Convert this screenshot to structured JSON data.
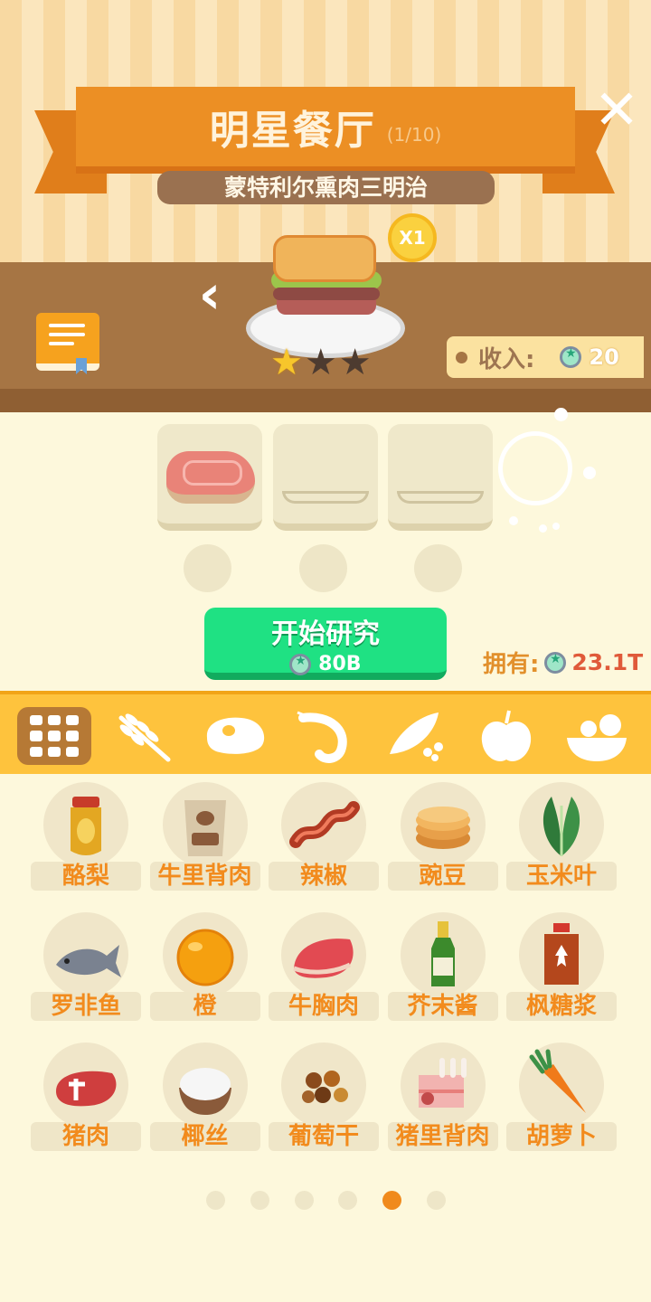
{
  "header": {
    "title": "明星餐厅",
    "progress": "(1/10)",
    "dish_name": "蒙特利尔熏肉三明治",
    "multiplier": "X1",
    "rating": 1,
    "rating_max": 3,
    "income_label": "收入:",
    "income_value": "20"
  },
  "research": {
    "slots": [
      {
        "filled": true,
        "item": "steak-icon"
      },
      {
        "filled": false,
        "item": "empty-plate-icon"
      },
      {
        "filled": false,
        "item": "empty-plate-icon"
      }
    ],
    "start_label": "开始研究",
    "start_cost": "80B",
    "owned_label": "拥有:",
    "owned_value": "23.1T"
  },
  "categories": [
    {
      "icon": "grid-icon",
      "active": true
    },
    {
      "icon": "wheat-icon",
      "active": false
    },
    {
      "icon": "meat-icon",
      "active": false
    },
    {
      "icon": "shrimp-icon",
      "active": false
    },
    {
      "icon": "pea-pod-icon",
      "active": false
    },
    {
      "icon": "apple-icon",
      "active": false
    },
    {
      "icon": "salad-bowl-icon",
      "active": false
    }
  ],
  "ingredients": [
    {
      "label": "酪梨",
      "icon": "honey-jar-icon"
    },
    {
      "label": "牛里背肉",
      "icon": "cocoa-bag-icon"
    },
    {
      "label": "辣椒",
      "icon": "bacon-icon"
    },
    {
      "label": "豌豆",
      "icon": "pancake-icon"
    },
    {
      "label": "玉米叶",
      "icon": "spinach-icon"
    },
    {
      "label": "罗非鱼",
      "icon": "fish-icon"
    },
    {
      "label": "橙",
      "icon": "orange-icon"
    },
    {
      "label": "牛胸肉",
      "icon": "beef-slab-icon"
    },
    {
      "label": "芥末酱",
      "icon": "sauce-bottle-icon"
    },
    {
      "label": "枫糖浆",
      "icon": "maple-syrup-icon"
    },
    {
      "label": "猪肉",
      "icon": "t-bone-icon"
    },
    {
      "label": "椰丝",
      "icon": "rice-bowl-icon"
    },
    {
      "label": "葡萄干",
      "icon": "raisins-icon"
    },
    {
      "label": "猪里背肉",
      "icon": "pork-rack-icon"
    },
    {
      "label": "胡萝卜",
      "icon": "carrot-icon"
    }
  ],
  "pager": {
    "count": 6,
    "active_index": 4
  },
  "colors": {
    "accent": "#f08a1c",
    "start_button": "#1fe183",
    "category_bar": "#fec33d"
  }
}
